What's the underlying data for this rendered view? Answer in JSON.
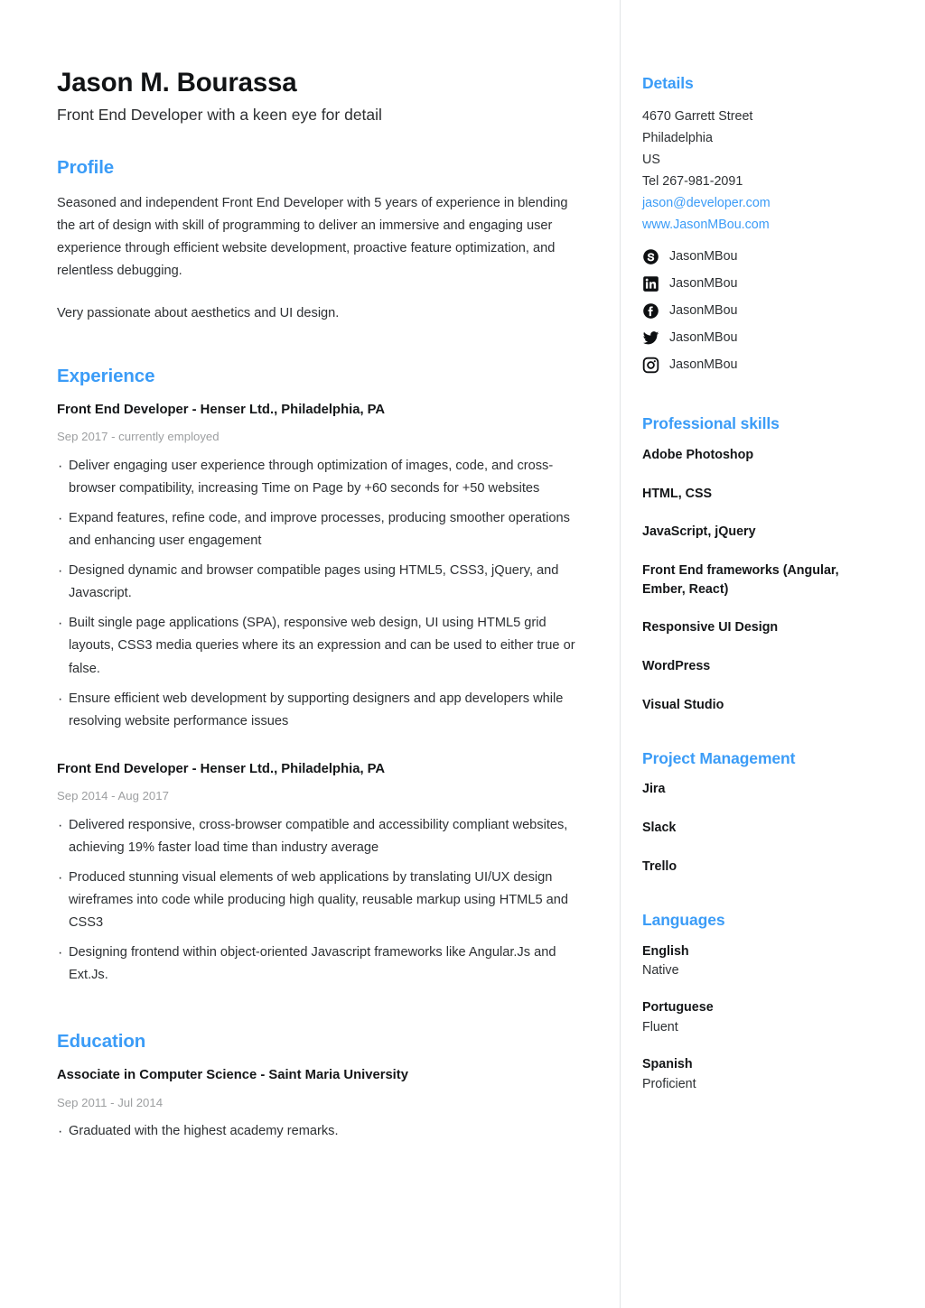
{
  "accent_color": "#3b9cf7",
  "muted_color": "#9d9fa1",
  "text_color": "#2d3033",
  "header": {
    "full_name": "Jason M. Bourassa",
    "job_title": "Front End Developer with a keen eye for detail"
  },
  "profile": {
    "heading": "Profile",
    "paragraphs": [
      "Seasoned and independent Front End Developer with 5 years of experience in blending the art of design with skill of programming to deliver an immersive and engaging user experience through efficient website development, proactive feature optimization, and relentless debugging.",
      "Very passionate about aesthetics and UI design."
    ]
  },
  "experience": {
    "heading": "Experience",
    "entries": [
      {
        "title": "Front End Developer - Henser Ltd., Philadelphia, PA",
        "date": "Sep 2017 - currently employed",
        "bullets": [
          "Deliver engaging user experience through optimization of images, code, and cross-browser compatibility, increasing Time on Page by +60 seconds for +50 websites",
          "Expand features, refine code, and improve processes, producing smoother operations and enhancing user engagement",
          "Designed dynamic and browser compatible pages using HTML5, CSS3, jQuery, and Javascript.",
          "Built single page applications (SPA), responsive web design, UI using HTML5 grid layouts, CSS3 media queries where its an expression and can be used to either true or false.",
          "Ensure efficient web development by supporting designers and app developers while resolving website performance issues"
        ]
      },
      {
        "title": "Front End Developer - Henser Ltd., Philadelphia, PA",
        "date": "Sep 2014 - Aug 2017",
        "bullets": [
          "Delivered responsive, cross-browser compatible and accessibility compliant websites, achieving 19% faster load time than industry average",
          "Produced stunning visual elements of web applications by translating UI/UX design wireframes into code while producing high quality, reusable markup using HTML5 and CSS3",
          "Designing frontend within object-oriented Javascript frameworks like Angular.Js and Ext.Js."
        ]
      }
    ]
  },
  "education": {
    "heading": "Education",
    "entries": [
      {
        "title": "Associate in Computer Science - Saint Maria University",
        "date": "Sep 2011 - Jul 2014",
        "bullets": [
          "Graduated with the highest academy remarks."
        ]
      }
    ]
  },
  "details": {
    "heading": "Details",
    "address_line1": "4670 Garrett Street",
    "address_line2": "Philadelphia",
    "country": "US",
    "phone": "Tel 267-981-2091",
    "email": "jason@developer.com",
    "website": "www.JasonMBou.com",
    "socials": [
      {
        "icon": "skype-icon",
        "handle": "JasonMBou"
      },
      {
        "icon": "linkedin-icon",
        "handle": "JasonMBou"
      },
      {
        "icon": "facebook-icon",
        "handle": "JasonMBou"
      },
      {
        "icon": "twitter-icon",
        "handle": "JasonMBou"
      },
      {
        "icon": "instagram-icon",
        "handle": "JasonMBou"
      }
    ]
  },
  "professional_skills": {
    "heading": "Professional skills",
    "items": [
      "Adobe Photoshop",
      "HTML, CSS",
      "JavaScript, jQuery",
      "Front End frameworks (Angular, Ember, React)",
      "Responsive UI Design",
      "WordPress",
      "Visual Studio"
    ]
  },
  "project_management": {
    "heading": "Project Management",
    "items": [
      "Jira",
      "Slack",
      "Trello"
    ]
  },
  "languages": {
    "heading": "Languages",
    "items": [
      {
        "name": "English",
        "level": "Native"
      },
      {
        "name": "Portuguese",
        "level": "Fluent"
      },
      {
        "name": "Spanish",
        "level": "Proficient"
      }
    ]
  }
}
